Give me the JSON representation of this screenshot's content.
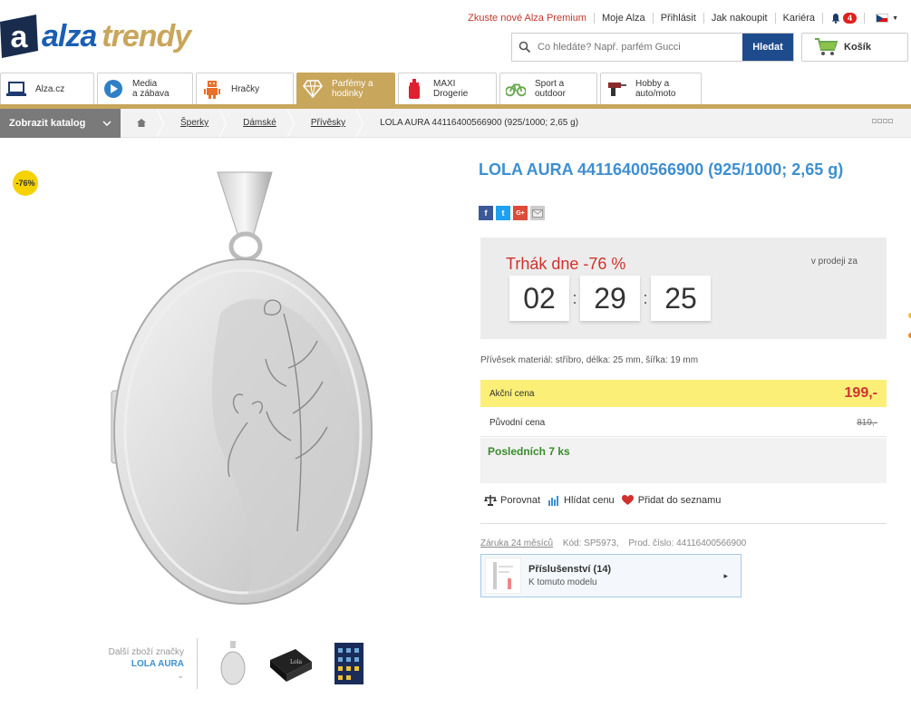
{
  "header": {
    "logo_alza": "alza",
    "logo_trendy": "trendy",
    "topnav": [
      "Zkuste nové Alza Premium",
      "Moje Alza",
      "Přihlásit",
      "Jak nakoupit",
      "Kariéra"
    ],
    "notification_count": "4",
    "search_placeholder": "Co hledáte? Např. parfém Gucci",
    "search_button": "Hledat",
    "cart_label": "Košík"
  },
  "tabs": [
    {
      "label": "Alza.cz",
      "icon": "laptop-icon"
    },
    {
      "label": "Media\na zábava",
      "icon": "play-icon"
    },
    {
      "label": "Hračky",
      "icon": "robot-icon"
    },
    {
      "label": "Parfémy a\nhodinky",
      "icon": "diamond-icon",
      "active": true
    },
    {
      "label": "MAXI\nDrogerie",
      "icon": "bottle-icon"
    },
    {
      "label": "Sport a\noutdoor",
      "icon": "bicycle-icon"
    },
    {
      "label": "Hobby a\nauto/moto",
      "icon": "drill-icon"
    }
  ],
  "breadcrumb": {
    "catalog_button": "Zobrazit katalog",
    "items": [
      "Šperky",
      "Dámské",
      "Přívěsky"
    ],
    "current": "LOLA AURA 44116400566900 (925/1000; 2,65 g)"
  },
  "product": {
    "discount_badge": "-76%",
    "title": "LOLA AURA 44116400566900 (925/1000; 2,65 g)",
    "deal_title": "Trhák dne -76 %",
    "deal_sub": "v prodeji za",
    "timer": {
      "hours": "02",
      "minutes": "29",
      "seconds": "25"
    },
    "material": "Přívěsek materiál: stříbro, délka: 25 mm, šířka: 19 mm",
    "sale_price_label": "Akční cena",
    "sale_price": "199,-",
    "orig_price_label": "Původní cena",
    "orig_price": "819,-",
    "stock": "Posledních 7 ks",
    "actions": [
      "Porovnat",
      "Hlídat cenu",
      "Přidat do seznamu"
    ],
    "warranty": "Záruka 24 měsíců",
    "code": "Kód: SP5973,",
    "prod_number": "Prod. číslo: 44116400566900",
    "accessory_title": "Příslušenství (14)",
    "accessory_sub": "K tomuto modelu",
    "more_brand_label": "Další zboží značky",
    "more_brand_name": "LOLA AURA"
  },
  "colors": {
    "accent_gold": "#c8a65b",
    "link_blue": "#3d8fd1",
    "deal_red": "#d0312d",
    "price_yellow": "#fbef78",
    "stock_green": "#3a8c2c"
  }
}
